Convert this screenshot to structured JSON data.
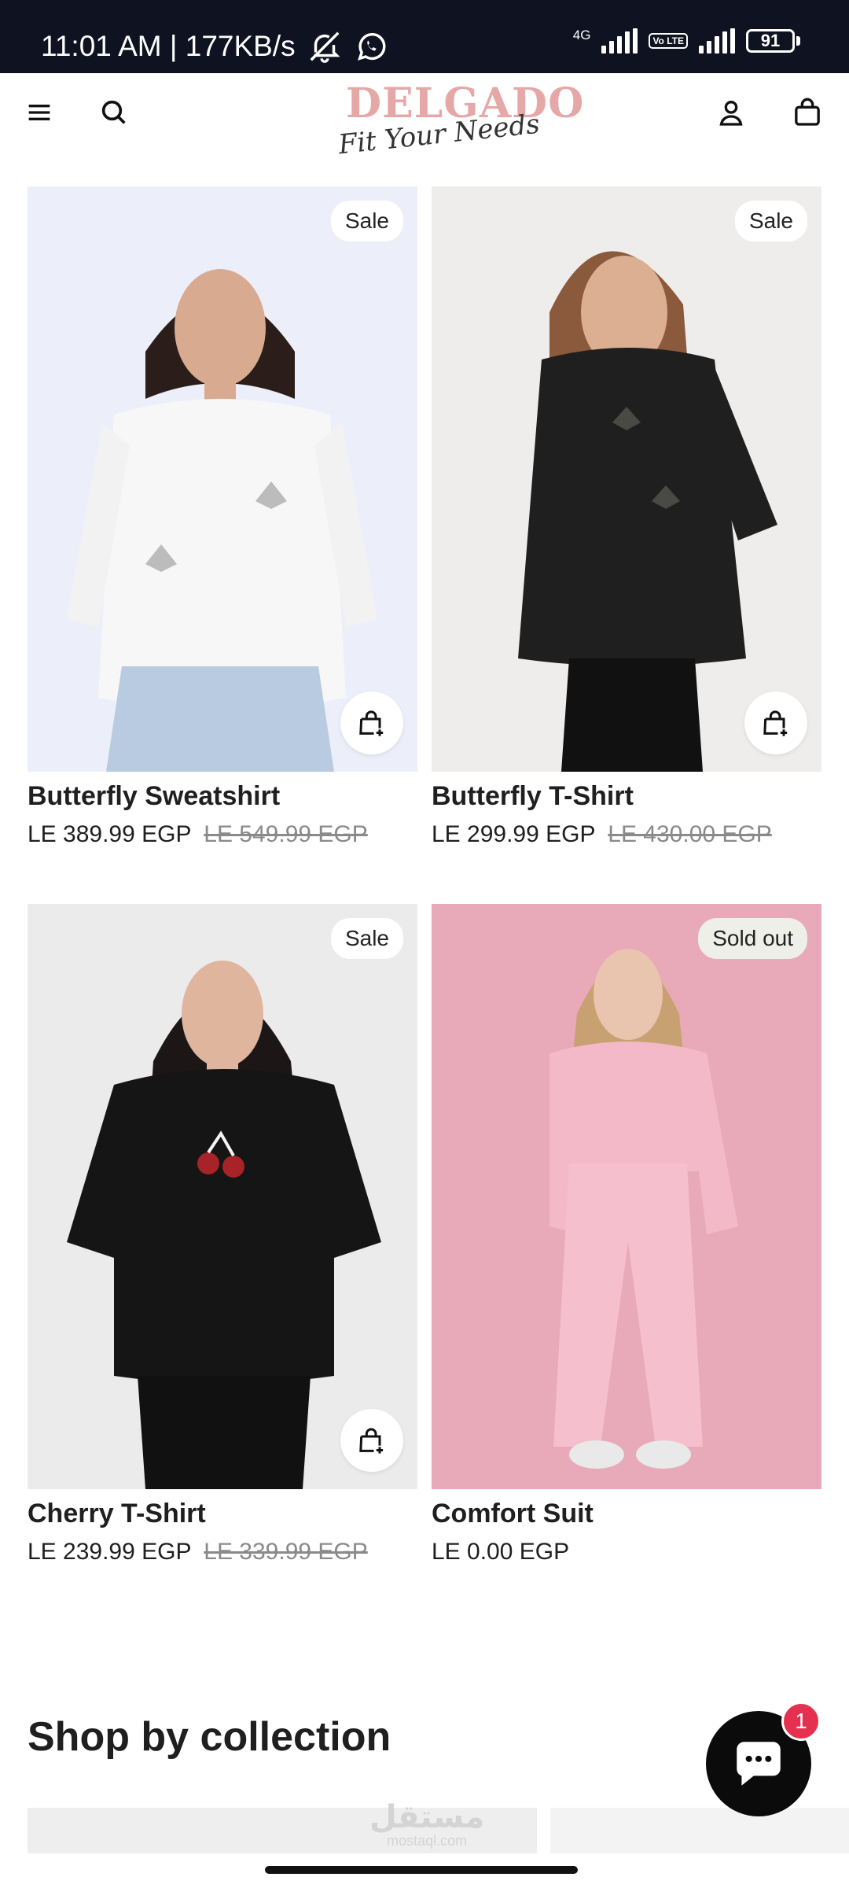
{
  "status_bar": {
    "time_speed": "11:01 AM | 177KB/s",
    "network_type": "4G",
    "volte": "Vo LTE",
    "battery": "91"
  },
  "header": {
    "brand": "DELGADO",
    "tagline": "Fit Your Needs",
    "icons": [
      "menu-icon",
      "search-icon",
      "account-icon",
      "bag-icon"
    ]
  },
  "products": [
    {
      "title": "Butterfly Sweatshirt",
      "price": "LE 389.99 EGP",
      "compare_price": "LE 549.99 EGP",
      "badge": "Sale"
    },
    {
      "title": "Butterfly T-Shirt",
      "price": "LE 299.99 EGP",
      "compare_price": "LE 430.00 EGP",
      "badge": "Sale"
    },
    {
      "title": "Cherry T-Shirt",
      "price": "LE 239.99 EGP",
      "compare_price": "LE 339.99 EGP",
      "badge": "Sale"
    },
    {
      "title": "Comfort Suit",
      "price": "LE 0.00 EGP",
      "compare_price": "",
      "badge": "Sold out"
    }
  ],
  "collections": {
    "title": "Shop by collection"
  },
  "watermark": {
    "arabic": "مستقل",
    "site": "mostaql.com"
  },
  "chat": {
    "unread_count": "1"
  },
  "colors": {
    "status_bar_bg": "#0f1220",
    "chat_badge": "#e5304f",
    "logo_pink": "#e5a8a6",
    "sold_out_badge_bg": "#eef0e8",
    "comfort_suit_bg": "#e8a9b8"
  }
}
